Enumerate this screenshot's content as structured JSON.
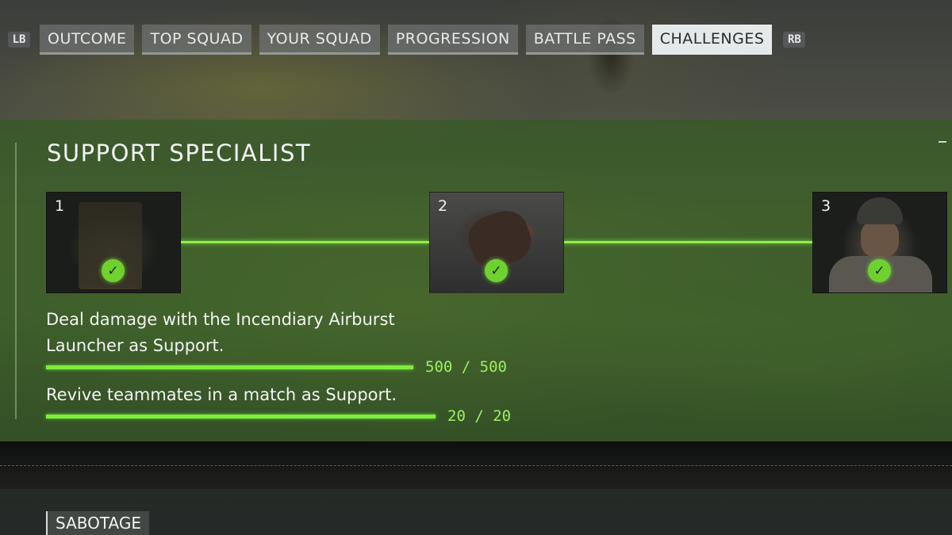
{
  "nav": {
    "left_bumper": "LB",
    "right_bumper": "RB",
    "tabs": [
      {
        "label": "OUTCOME",
        "active": false
      },
      {
        "label": "TOP SQUAD",
        "active": false
      },
      {
        "label": "YOUR SQUAD",
        "active": false
      },
      {
        "label": "PROGRESSION",
        "active": false
      },
      {
        "label": "BATTLE PASS",
        "active": false
      },
      {
        "label": "CHALLENGES",
        "active": true
      }
    ]
  },
  "challenge": {
    "title": "SUPPORT SPECIALIST",
    "tiers": [
      {
        "number": "1",
        "completed": true,
        "icon": "backpack-image"
      },
      {
        "number": "2",
        "completed": true,
        "icon": "explosion-soldier-image"
      },
      {
        "number": "3",
        "completed": true,
        "icon": "soldier-portrait-image"
      }
    ],
    "tasks": [
      {
        "line1": "Deal damage with the Incendiary Airburst",
        "line2": "Launcher as Support.",
        "progress": "500 / 500",
        "fraction": 1.0
      },
      {
        "line1": "Revive teammates in a match as Support.",
        "line2": "",
        "progress": "20 / 20",
        "fraction": 1.0
      }
    ],
    "collapse_symbol": "–"
  },
  "next_section": {
    "title": "SABOTAGE"
  },
  "colors": {
    "accent": "#7cee3c",
    "panel": "#345a26",
    "active_tab": "#e6e9ea"
  },
  "icons": {
    "check": "checkmark-icon"
  }
}
